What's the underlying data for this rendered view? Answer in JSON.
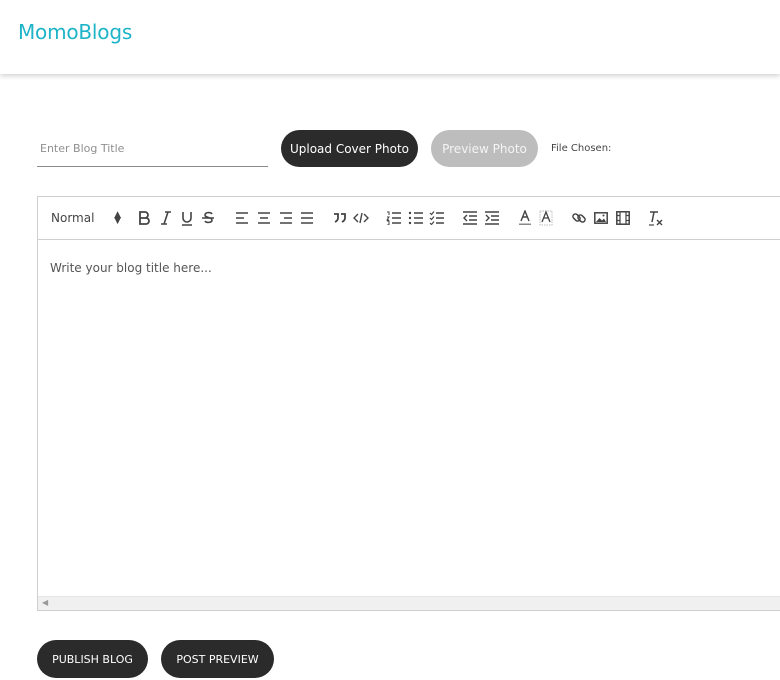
{
  "navbar": {
    "brand": "MomoBlogs"
  },
  "form": {
    "title_placeholder": "Enter Blog Title",
    "upload_label": "Upload Cover Photo",
    "preview_photo_label": "Preview Photo",
    "file_chosen_label": "File Chosen:"
  },
  "editor": {
    "header_select": "Normal",
    "placeholder_text": "Write your blog title here...",
    "toolbar_buttons": [
      "bold-icon",
      "italic-icon",
      "underline-icon",
      "strike-icon",
      "align-left-icon",
      "align-center-icon",
      "align-right-icon",
      "align-justify-icon",
      "blockquote-icon",
      "code-icon",
      "ordered-list-icon",
      "bullet-list-icon",
      "check-list-icon",
      "outdent-icon",
      "indent-icon",
      "text-color-icon",
      "background-color-icon",
      "link-icon",
      "image-icon",
      "video-icon",
      "clear-format-icon"
    ]
  },
  "actions": {
    "publish_label": "PUBLISH BLOG",
    "post_preview_label": "POST PREVIEW"
  },
  "colors": {
    "brand": "#1eb4c8",
    "dark_button": "#2b2b2b",
    "disabled_button": "#bdbdbd"
  }
}
